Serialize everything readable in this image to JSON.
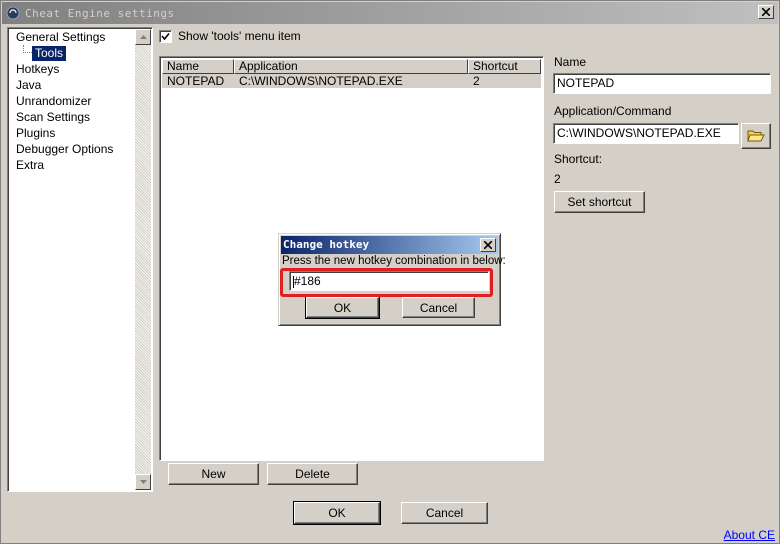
{
  "window": {
    "title": "Cheat Engine settings",
    "icons": {
      "app": "cheat-engine-icon",
      "close": "close-icon"
    }
  },
  "sidebar": {
    "items": [
      {
        "label": "General Settings",
        "selected": false,
        "child": false
      },
      {
        "label": "Tools",
        "selected": true,
        "child": true
      },
      {
        "label": "Hotkeys",
        "selected": false,
        "child": false
      },
      {
        "label": "Java",
        "selected": false,
        "child": false
      },
      {
        "label": "Unrandomizer",
        "selected": false,
        "child": false
      },
      {
        "label": "Scan Settings",
        "selected": false,
        "child": false
      },
      {
        "label": "Plugins",
        "selected": false,
        "child": false
      },
      {
        "label": "Debugger Options",
        "selected": false,
        "child": false
      },
      {
        "label": "Extra",
        "selected": false,
        "child": false
      }
    ]
  },
  "tools": {
    "show_menu_label": "Show 'tools' menu item",
    "show_menu_checked": true,
    "columns": [
      "Name",
      "Application",
      "Shortcut"
    ],
    "rows": [
      {
        "name": "NOTEPAD",
        "application": "C:\\WINDOWS\\NOTEPAD.EXE",
        "shortcut": "2"
      }
    ],
    "new_label": "New",
    "delete_label": "Delete"
  },
  "details": {
    "name_label": "Name",
    "name_value": "NOTEPAD",
    "app_label": "Application/Command",
    "app_value": "C:\\WINDOWS\\NOTEPAD.EXE",
    "shortcut_label": "Shortcut:",
    "shortcut_value": "2",
    "set_shortcut_label": "Set shortcut",
    "browse_icon": "folder-open-icon"
  },
  "footer": {
    "ok_label": "OK",
    "cancel_label": "Cancel",
    "about_label": "About CE"
  },
  "dialog": {
    "title": "Change hotkey",
    "prompt": "Press the new hotkey combination in below:",
    "hotkey_value": "#186",
    "ok_label": "OK",
    "cancel_label": "Cancel",
    "highlight_color": "#e02020"
  }
}
